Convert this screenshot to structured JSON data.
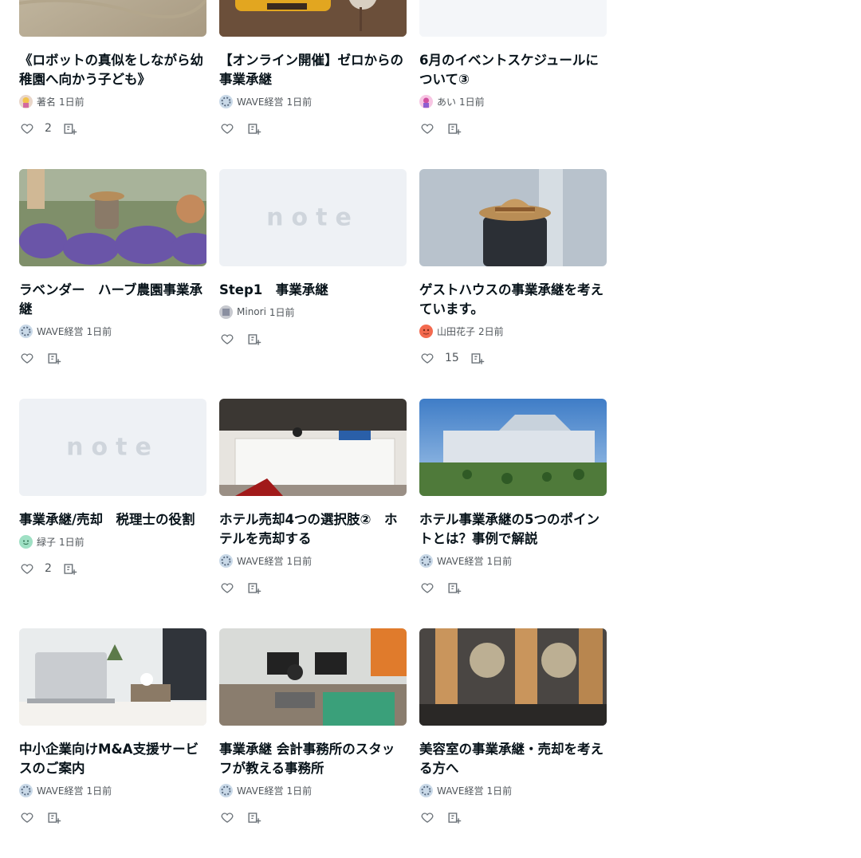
{
  "rows": [
    [
      {
        "title": "《ロボットの真似をしながら幼稚園へ向かう子ども》",
        "author": "著名",
        "time": "1日前",
        "likes": "2",
        "thumb": "texture",
        "avatar": "pink-girl"
      },
      {
        "title": "【オンライン開催】ゼロからの事業承継",
        "author": "WAVE経営",
        "time": "1日前",
        "likes": "",
        "thumb": "sofa",
        "avatar": "wave"
      },
      {
        "title": "6月のイベントスケジュールについて③",
        "author": "あい",
        "time": "1日前",
        "likes": "",
        "thumb": "blank",
        "avatar": "pink-girl2"
      }
    ],
    [
      {
        "title": "ラベンダー　ハーブ農園事業承継",
        "author": "WAVE経営",
        "time": "1日前",
        "likes": "",
        "thumb": "lavender",
        "avatar": "wave"
      },
      {
        "title": "Step1　事業承継",
        "author": "Minori",
        "time": "1日前",
        "likes": "",
        "thumb": "note",
        "avatar": "minori"
      },
      {
        "title": "ゲストハウスの事業承継を考えています。",
        "author": "山田花子",
        "time": "2日前",
        "likes": "15",
        "thumb": "suitcase",
        "avatar": "red"
      }
    ],
    [
      {
        "title": "事業承継/売却　税理士の役割",
        "author": "緑子",
        "time": "1日前",
        "likes": "2",
        "thumb": "note",
        "avatar": "green"
      },
      {
        "title": "ホテル売却4つの選択肢②　ホテルを売却する",
        "author": "WAVE経営",
        "time": "1日前",
        "likes": "",
        "thumb": "hotel-desk",
        "avatar": "wave"
      },
      {
        "title": "ホテル事業承継の5つのポイントとは？事例で解説",
        "author": "WAVE経営",
        "time": "1日前",
        "likes": "",
        "thumb": "hotel-building",
        "avatar": "wave"
      }
    ],
    [
      {
        "title": "中小企業向けM&A支援サービスのご案内",
        "author": "WAVE経営",
        "time": "1日前",
        "likes": "",
        "thumb": "laptop",
        "avatar": "wave"
      },
      {
        "title": "事業承継 会計事務所のスタッフが教える事務所",
        "author": "WAVE経営",
        "time": "1日前",
        "likes": "",
        "thumb": "office",
        "avatar": "wave"
      },
      {
        "title": "美容室の事業承継・売却を考える方へ",
        "author": "WAVE経営",
        "time": "1日前",
        "likes": "",
        "thumb": "salon",
        "avatar": "wave"
      }
    ]
  ],
  "placeholder_logo": "note",
  "colors": {
    "icon": "#6b7278",
    "text": "#08131a",
    "meta": "#50565b",
    "placeholder": "#eef1f5"
  }
}
